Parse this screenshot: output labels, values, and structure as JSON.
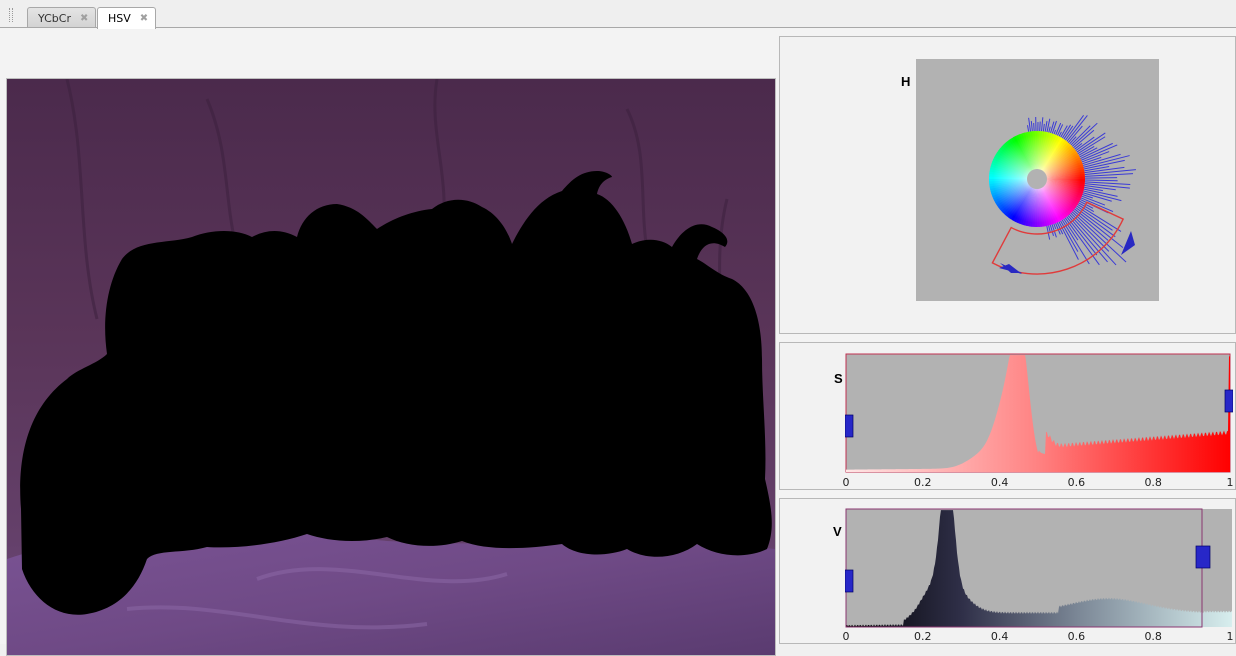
{
  "tabs": [
    {
      "label": "YCbCr",
      "active": false
    },
    {
      "label": "HSV",
      "active": true
    }
  ],
  "hue_panel": {
    "title": "H"
  },
  "saturation_panel": {
    "title": "S",
    "ticks": [
      "0",
      "0.2",
      "0.4",
      "0.6",
      "0.8",
      "1"
    ],
    "range_low": 0.0,
    "range_high": 1.0,
    "color_start": "#ffe6e6",
    "color_end": "#ff0000"
  },
  "value_panel": {
    "title": "V",
    "ticks": [
      "0",
      "0.2",
      "0.4",
      "0.6",
      "0.8",
      "1"
    ],
    "range_low": 0.0,
    "range_high": 0.93,
    "color_start": "#000000",
    "color_end": "#d7eeee"
  },
  "colors": {
    "plot_bg": "#b2b2b2",
    "handle": "#2727c8",
    "range_border": "#c03050",
    "hue_range": "#e03b3b",
    "background_cloth": "#563355"
  }
}
